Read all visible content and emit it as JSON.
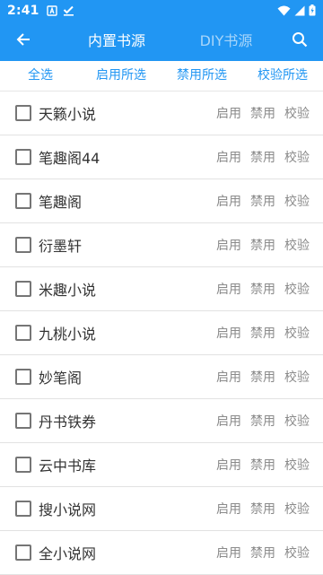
{
  "status_bar": {
    "time": "2:41",
    "icons": [
      "sim-a-icon",
      "download-done-icon",
      "wifi-icon",
      "signal-icon",
      "battery-charging-icon"
    ]
  },
  "app_bar": {
    "back_icon": "arrow-left-icon",
    "tabs": [
      {
        "label": "内置书源",
        "active": true
      },
      {
        "label": "DIY书源",
        "active": false
      }
    ],
    "search_icon": "search-icon"
  },
  "actions": {
    "select_all": "全选",
    "enable_selected": "启用所选",
    "disable_selected": "禁用所选",
    "verify_selected": "校验所选"
  },
  "row_actions": {
    "enable": "启用",
    "disable": "禁用",
    "verify": "校验"
  },
  "sources": [
    {
      "name": "天籁小说",
      "checked": false
    },
    {
      "name": "笔趣阁44",
      "checked": false
    },
    {
      "name": "笔趣阁",
      "checked": false
    },
    {
      "name": "衍墨轩",
      "checked": false
    },
    {
      "name": "米趣小说",
      "checked": false
    },
    {
      "name": "九桃小说",
      "checked": false
    },
    {
      "name": "妙笔阁",
      "checked": false
    },
    {
      "name": "丹书铁券",
      "checked": false
    },
    {
      "name": "云中书库",
      "checked": false
    },
    {
      "name": "搜小说网",
      "checked": false
    },
    {
      "name": "全小说网",
      "checked": false
    }
  ],
  "colors": {
    "primary": "#2196f3",
    "action_text": "#2196f3",
    "row_text": "#333333",
    "row_action_text": "#8a8a8a",
    "divider": "#e2e2e2"
  }
}
